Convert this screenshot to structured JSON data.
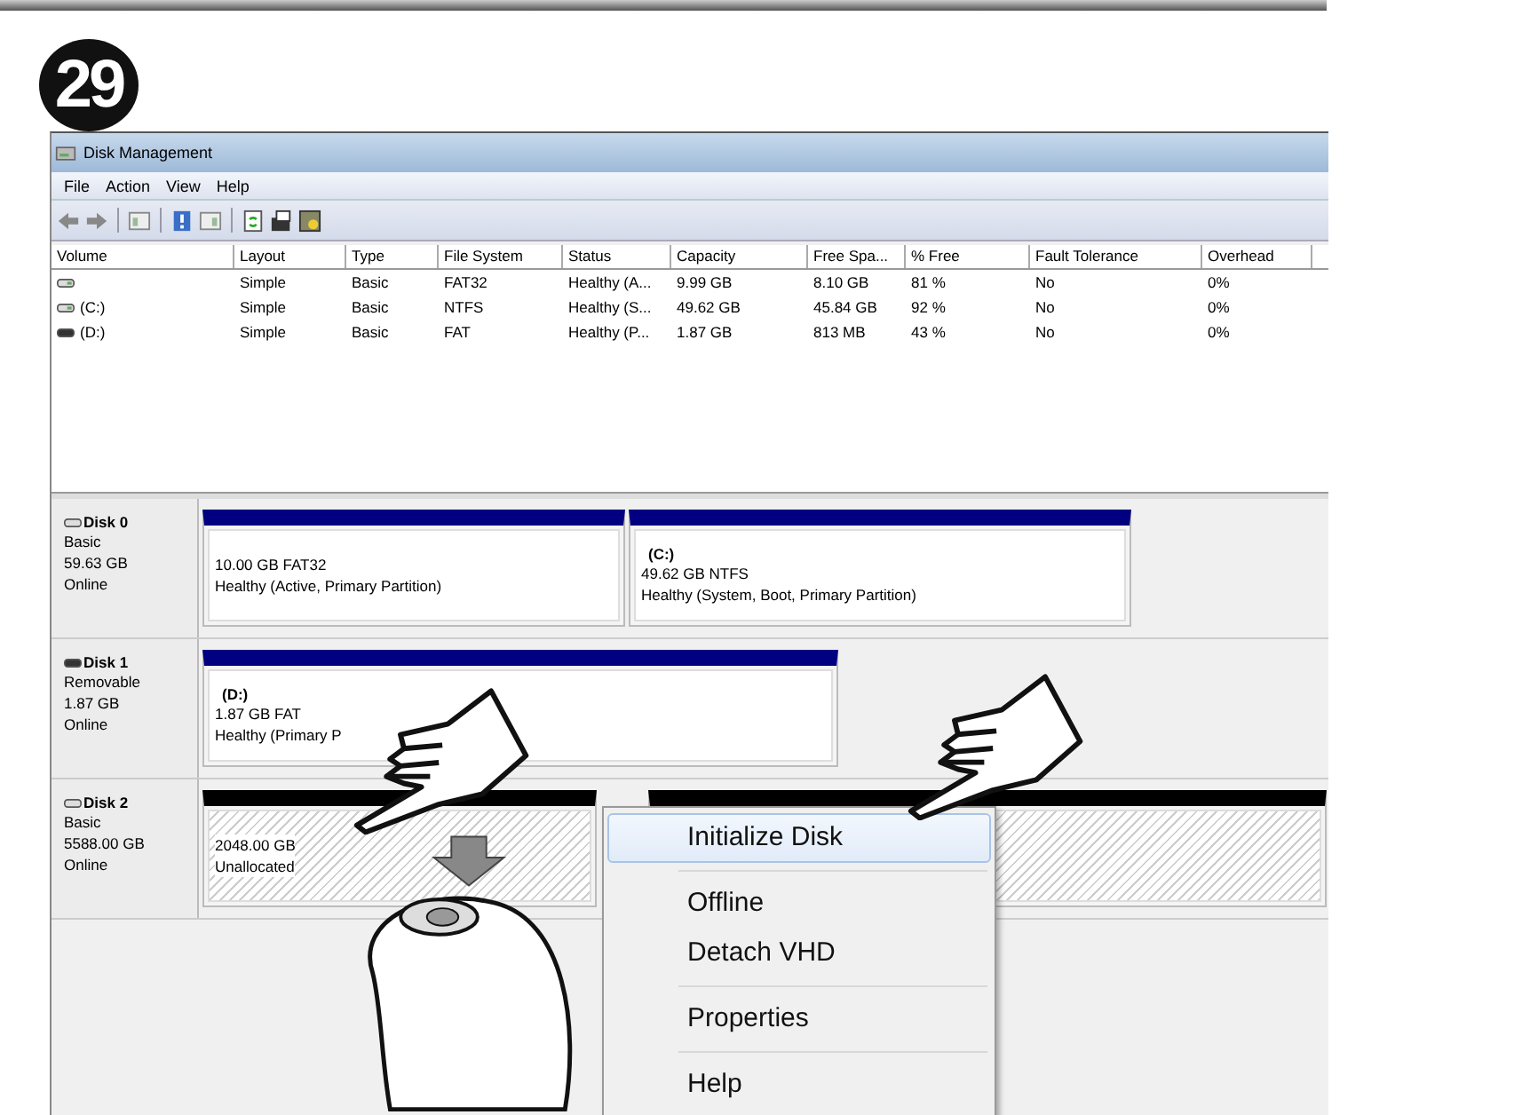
{
  "step_badge": "29",
  "window": {
    "title": "Disk Management"
  },
  "menu": [
    "File",
    "Action",
    "View",
    "Help"
  ],
  "table": {
    "columns": [
      "Volume",
      "Layout",
      "Type",
      "File System",
      "Status",
      "Capacity",
      "Free Spa...",
      "% Free",
      "Fault Tolerance",
      "Overhead"
    ],
    "rows": [
      {
        "kind": "fixed",
        "cells": [
          "",
          "Simple",
          "Basic",
          "FAT32",
          "Healthy (A...",
          "9.99 GB",
          "8.10 GB",
          "81 %",
          "No",
          "0%"
        ]
      },
      {
        "kind": "fixed",
        "cells": [
          "(C:)",
          "Simple",
          "Basic",
          "NTFS",
          "Healthy (S...",
          "49.62 GB",
          "45.84 GB",
          "92 %",
          "No",
          "0%"
        ]
      },
      {
        "kind": "removable",
        "cells": [
          "(D:)",
          "Simple",
          "Basic",
          "FAT",
          "Healthy (P...",
          "1.87 GB",
          "813 MB",
          "43 %",
          "No",
          "0%"
        ]
      }
    ]
  },
  "disks": [
    {
      "kind": "fixed",
      "name": "Disk 0",
      "info": [
        "Basic",
        "59.63 GB",
        "Online"
      ],
      "partitions": [
        {
          "kind": "primary",
          "lines": [
            "10.00 GB FAT32",
            "Healthy (Active, Primary Partition)"
          ]
        },
        {
          "kind": "primary",
          "drive": "(C:)",
          "lines": [
            "49.62 GB NTFS",
            "Healthy (System, Boot, Primary Partition)"
          ]
        }
      ]
    },
    {
      "kind": "removable",
      "name": "Disk 1",
      "info": [
        "Removable",
        "1.87 GB",
        "Online"
      ],
      "partitions": [
        {
          "kind": "primary",
          "drive": "(D:)",
          "lines": [
            "1.87 GB FAT",
            "Healthy (Primary P"
          ]
        }
      ]
    },
    {
      "kind": "fixed",
      "name": "Disk 2",
      "info": [
        "Basic",
        "5588.00 GB",
        "Online"
      ],
      "partitions": [
        {
          "kind": "unallocated",
          "lines": [
            "2048.00 GB",
            "Unallocated"
          ]
        },
        {
          "kind": "unallocated"
        }
      ]
    }
  ],
  "context_menu": [
    [
      {
        "label": "Initialize Disk",
        "selected": true
      }
    ],
    [
      {
        "label": "Offline",
        "selected": false
      },
      {
        "label": "Detach VHD",
        "selected": false
      }
    ],
    [
      {
        "label": "Properties",
        "selected": false
      }
    ],
    [
      {
        "label": "Help",
        "selected": false
      }
    ]
  ]
}
